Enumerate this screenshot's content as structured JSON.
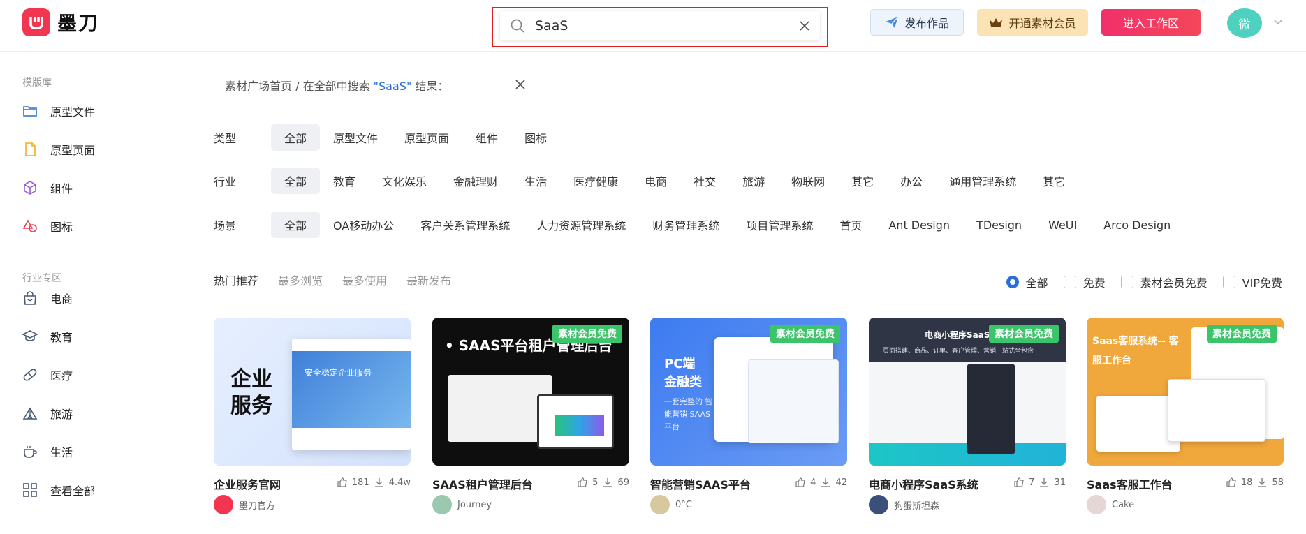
{
  "brand": {
    "name": "墨刀"
  },
  "search": {
    "value": "SaaS",
    "placeholder": ""
  },
  "header": {
    "publish_label": "发布作品",
    "vip_label": "开通素材会员",
    "workspace_label": "进入工作区",
    "avatar_text": "微"
  },
  "sidebar": {
    "section1": "模版库",
    "items1": [
      {
        "label": "原型文件",
        "icon": "folder-icon"
      },
      {
        "label": "原型页面",
        "icon": "page-icon"
      },
      {
        "label": "组件",
        "icon": "cube-icon"
      },
      {
        "label": "图标",
        "icon": "shapes-icon"
      }
    ],
    "section2": "行业专区",
    "items2": [
      {
        "label": "电商",
        "icon": "shopping-bag-icon"
      },
      {
        "label": "教育",
        "icon": "graduation-cap-icon"
      },
      {
        "label": "医疗",
        "icon": "pill-icon"
      },
      {
        "label": "旅游",
        "icon": "tent-icon"
      },
      {
        "label": "生活",
        "icon": "coffee-cup-icon"
      },
      {
        "label": "查看全部",
        "icon": "grid-icon"
      }
    ]
  },
  "breadcrumb": {
    "prefix": "素材广场首页 / 在全部中搜索 ",
    "keyword": "\"SaaS\"",
    "suffix": " 结果："
  },
  "filters": {
    "type": {
      "label": "类型",
      "options": [
        "全部",
        "原型文件",
        "原型页面",
        "组件",
        "图标"
      ]
    },
    "industry": {
      "label": "行业",
      "options": [
        "全部",
        "教育",
        "文化娱乐",
        "金融理财",
        "生活",
        "医疗健康",
        "电商",
        "社交",
        "旅游",
        "物联网",
        "其它",
        "办公",
        "通用管理系统",
        "其它"
      ]
    },
    "scene": {
      "label": "场景",
      "options": [
        "全部",
        "OA移动办公",
        "客户关系管理系统",
        "人力资源管理系统",
        "财务管理系统",
        "项目管理系统",
        "首页",
        "Ant Design",
        "TDesign",
        "WeUI",
        "Arco Design"
      ]
    }
  },
  "sorts": [
    "热门推荐",
    "最多浏览",
    "最多使用",
    "最新发布"
  ],
  "pricing": [
    "全部",
    "免费",
    "素材会员免费",
    "VIP免费"
  ],
  "cards": [
    {
      "title": "企业服务官网",
      "likes": "181",
      "uses": "4.4w",
      "author": "墨刀官方",
      "badge": "",
      "thumb_title": "企业服务",
      "thumb_sub": "安全稳定企业服务"
    },
    {
      "title": "SAAS租户管理后台",
      "likes": "5",
      "uses": "69",
      "author": "Journey",
      "badge": "素材会员免费",
      "thumb_title": "• SAAS平台租户管理后台"
    },
    {
      "title": "智能营销SAAS平台",
      "likes": "4",
      "uses": "42",
      "author": "0°C",
      "badge": "素材会员免费",
      "thumb_title": "PC端 金融类",
      "thumb_sub": "一套完整的 智能营销 SAAS平台"
    },
    {
      "title": "电商小程序SaaS系统",
      "likes": "7",
      "uses": "31",
      "author": "狗蛋斯坦森",
      "badge": "素材会员免费",
      "thumb_title": "电商小程序SaaS系统",
      "thumb_sub": "页面搭建、商品、订单、客户管理、营销一站式全包含"
    },
    {
      "title": "Saas客服工作台",
      "likes": "18",
      "uses": "58",
      "author": "Cake",
      "badge": "素材会员免费",
      "thumb_title": "Saas客服系统-- 客服工作台"
    }
  ],
  "colors": {
    "brand": "#f2364f",
    "accent": "#2a6fd6",
    "badge": "#3cc46a"
  }
}
